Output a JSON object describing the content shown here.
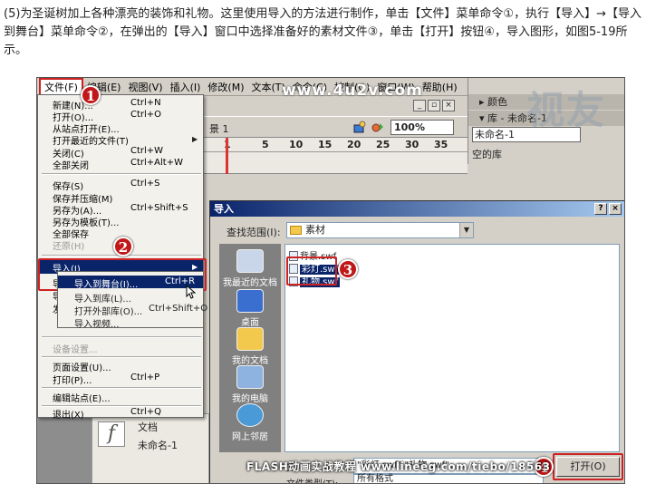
{
  "intro": {
    "text": "(5)为圣诞树加上各种漂亮的装饰和礼物。这里使用导入的方法进行制作，单击【文件】菜单命令①，执行【导入】→【导入到舞台】菜单命令②，在弹出的【导入】窗口中选择准备好的素材文件③，单击【打开】按钮④，导入图形，如图5-19所示。"
  },
  "menubar": {
    "items": [
      "文件(F)",
      "编辑(E)",
      "视图(V)",
      "插入(I)",
      "修改(M)",
      "文本(T)",
      "命令(C)",
      "控制(O)",
      "窗口(W)",
      "帮助(H)"
    ]
  },
  "watermark_top": "www.4u2v.com",
  "watermark_logo": "视友",
  "watermark_bottom": "FLASH动画实战教程 www.lineeg.com/tiebo/18563",
  "window_buttons": [
    "_",
    "▫",
    "×"
  ],
  "toolbar": {
    "scene": "景 1",
    "zoom": "100%"
  },
  "timeline": {
    "ticks": [
      "1",
      "5",
      "10",
      "15",
      "20",
      "25",
      "30",
      "35"
    ]
  },
  "right_panel": {
    "color_header": "颜色",
    "library_header": "库 - 未命名-1",
    "library_select": "未命名-1",
    "empty_library": "空的库"
  },
  "lower_left": {
    "doc_label": "文档",
    "doc_name": "未命名-1"
  },
  "file_menu": {
    "items": [
      {
        "label": "新建(N)...",
        "shortcut": "Ctrl+N"
      },
      {
        "label": "打开(O)...",
        "shortcut": "Ctrl+O"
      },
      {
        "label": "从站点打开(E)...",
        "shortcut": ""
      },
      {
        "label": "打开最近的文件(T)",
        "shortcut": ""
      },
      {
        "label": "关闭(C)",
        "shortcut": "Ctrl+W"
      },
      {
        "label": "全部关闭",
        "shortcut": "Ctrl+Alt+W"
      },
      {
        "label": "保存(S)",
        "shortcut": "Ctrl+S"
      },
      {
        "label": "保存并压缩(M)",
        "shortcut": ""
      },
      {
        "label": "另存为(A)...",
        "shortcut": "Ctrl+Shift+S"
      },
      {
        "label": "另存为模板(T)...",
        "shortcut": ""
      },
      {
        "label": "全部保存",
        "shortcut": ""
      },
      {
        "label": "还原(H)",
        "shortcut": ""
      },
      {
        "label": "导入(I)",
        "shortcut": ""
      },
      {
        "label": "导",
        "shortcut": ""
      },
      {
        "label": "导",
        "shortcut": ""
      },
      {
        "label": "发",
        "shortcut": ""
      },
      {
        "label": "设备设置...",
        "shortcut": ""
      },
      {
        "label": "页面设置(U)...",
        "shortcut": ""
      },
      {
        "label": "打印(P)...",
        "shortcut": "Ctrl+P"
      },
      {
        "label": "编辑站点(E)...",
        "shortcut": ""
      },
      {
        "label": "退出(X)",
        "shortcut": "Ctrl+Q"
      }
    ]
  },
  "import_submenu": {
    "items": [
      {
        "label": "导入到舞台(I)...",
        "shortcut": "Ctrl+R"
      },
      {
        "label": "导入到库(L)...",
        "shortcut": ""
      },
      {
        "label": "打开外部库(O)...",
        "shortcut": "Ctrl+Shift+O"
      },
      {
        "label": "导入视频...",
        "shortcut": ""
      }
    ]
  },
  "badges": [
    "1",
    "2",
    "3",
    "4"
  ],
  "dialog": {
    "title": "导入",
    "title_buttons": [
      "?",
      "×"
    ],
    "look_in_label": "查找范围(I):",
    "look_in_value": "素材",
    "places": [
      "我最近的文档",
      "桌面",
      "我的文档",
      "我的电脑",
      "网上邻居"
    ],
    "files": [
      "背景.swf",
      "彩灯.swf",
      "礼物.swf"
    ],
    "filename_label": "文",
    "filename_value": "\"彩灯.swf\" \"礼物.swf\"",
    "filetype_label": "文件类型(T):",
    "filetype_value": "所有格式",
    "open_button": "打开(O)"
  },
  "colors": {
    "highlight": "#cc2222",
    "selection": "#0a246a",
    "badge": "#c01818"
  }
}
